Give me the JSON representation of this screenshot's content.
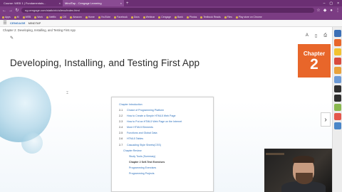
{
  "browser": {
    "tabs": [
      {
        "label": "Course: WEB 1 | Fundamentals...",
        "active": false
      },
      {
        "label": "MindTap - Cengage Learning",
        "active": true
      }
    ],
    "new_tab": "+",
    "url": "ng.cengage.com/static/nb/ui/evo/index.html",
    "bookmarks": [
      "Apps",
      "M",
      "WEB",
      "Work",
      "Netflix",
      "CIS",
      "Amazon",
      "Home",
      "YouTube",
      "Facebook",
      "Docs",
      "Webinar",
      "Cengage",
      "Bank",
      "Photos",
      "Textbook Reads",
      "Files",
      "Play store on Chrome"
    ]
  },
  "reader": {
    "brand": "CENGAGE",
    "product": "MINDTAP",
    "breadcrumb": "Chapter 2: Developing, Installing, and Testing First App"
  },
  "page": {
    "chapter_title": "Developing, Installing, and Testing First App",
    "chapter_badge_label": "Chapter",
    "chapter_badge_number": "2",
    "toc_intro": "Chapter Introduction",
    "toc_items": [
      {
        "num": "2-1",
        "text": "Choice of Programming Platform"
      },
      {
        "num": "2-2",
        "text": "How to Create a Simple HTML5 Web Page"
      },
      {
        "num": "2-3",
        "text": "How to Put an HTML5 Web Page on the Internet"
      },
      {
        "num": "2-4",
        "text": "More HTML5 Elements"
      },
      {
        "num": "2-5",
        "text": "Functions and Global Data"
      },
      {
        "num": "2-6",
        "text": "HTML5 Tables"
      },
      {
        "num": "2-7",
        "text": "Cascading Style Sheets(CSS)"
      }
    ],
    "toc_subs": [
      {
        "text": "Chapter Review",
        "level": 1,
        "bold": false
      },
      {
        "text": "Study Tools (Summary)",
        "level": 2,
        "bold": false
      },
      {
        "text": "Chapter 2  Self-Test Exercises",
        "level": 2,
        "bold": true
      },
      {
        "text": "Programming Exercises",
        "level": 2,
        "bold": false
      },
      {
        "text": "Programming Projects",
        "level": 2,
        "bold": false
      }
    ]
  },
  "colors": {
    "browser_chrome": "#7b3c83",
    "chapter_badge": "#e8662a",
    "link": "#2a6ebb"
  }
}
